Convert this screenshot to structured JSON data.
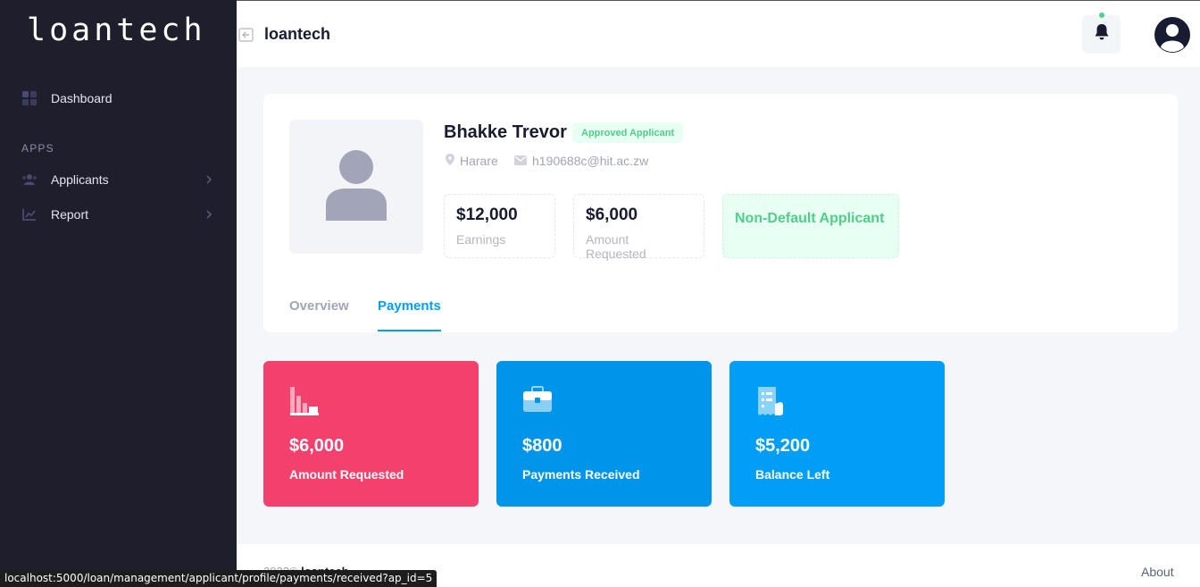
{
  "sidebar": {
    "brand": "loantech",
    "dashboard_label": "Dashboard",
    "section_label": "APPS",
    "items": [
      {
        "label": "Applicants",
        "icon": "users-icon"
      },
      {
        "label": "Report",
        "icon": "chart-icon"
      }
    ]
  },
  "header": {
    "title": "loantech",
    "notification_dot_color": "#50cd89"
  },
  "profile": {
    "name": "Bhakke Trevor",
    "badge": "Approved Applicant",
    "location": "Harare",
    "email": "h190688c@hit.ac.zw",
    "stats": [
      {
        "value": "$12,000",
        "label": "Earnings"
      },
      {
        "value": "$6,000",
        "label": "Amount Requested"
      }
    ],
    "status": "Non-Default Applicant"
  },
  "tabs": [
    {
      "label": "Overview",
      "active": false
    },
    {
      "label": "Payments",
      "active": true
    }
  ],
  "tiles": [
    {
      "value": "$6,000",
      "label": "Amount Requested",
      "color": "#f1416c",
      "icon": "bar-chart-icon"
    },
    {
      "value": "$800",
      "label": "Payments Received",
      "color": "#0095e8",
      "icon": "briefcase-icon"
    },
    {
      "value": "$5,200",
      "label": "Balance Left",
      "color": "#009ef7",
      "icon": "receipt-icon"
    }
  ],
  "footer": {
    "copyright_prefix": "2022©",
    "copyright_brand": "loantech",
    "about": "About"
  },
  "status_url": "localhost:5000/loan/management/applicant/profile/payments/received?ap_id=5"
}
